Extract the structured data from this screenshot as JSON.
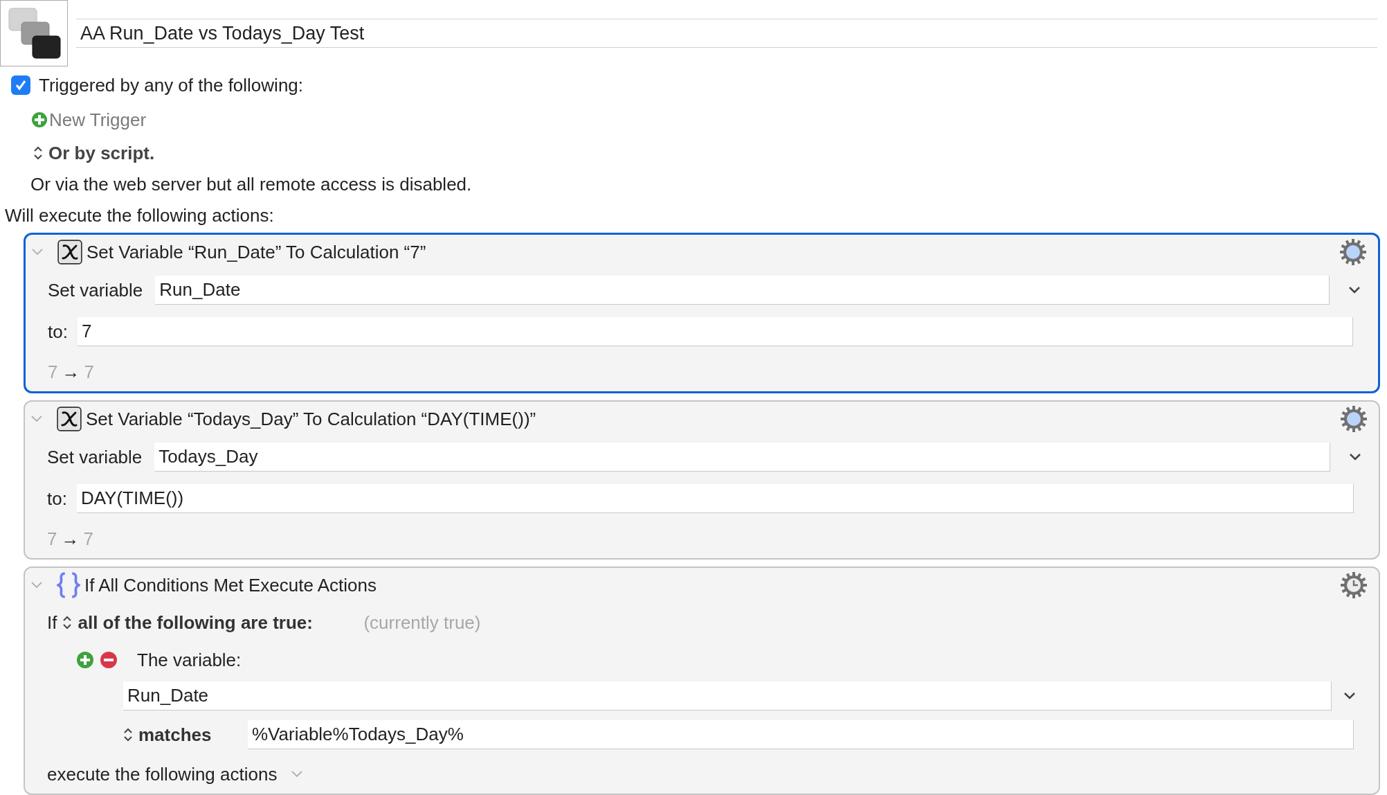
{
  "macro": {
    "name": "AA Run_Date vs Todays_Day Test"
  },
  "trigger": {
    "checked": true,
    "label": "Triggered by any of the following:"
  },
  "new_trigger": "New Trigger",
  "script_option": "Or by script.",
  "web_note": "Or via the web server but all remote access is disabled.",
  "actions_heading": "Will execute the following actions:",
  "actions": [
    {
      "kind": "set_variable",
      "selected": true,
      "title": "Set Variable “Run_Date” To Calculation “7”",
      "variable_label": "Set variable",
      "variable": "Run_Date",
      "to_label": "to:",
      "value": "7",
      "preview_from": "7",
      "arrow": "→",
      "preview_to": "7"
    },
    {
      "kind": "set_variable",
      "selected": false,
      "title": "Set Variable “Todays_Day” To Calculation “DAY(TIME())”",
      "variable_label": "Set variable",
      "variable": "Todays_Day",
      "to_label": "to:",
      "value": "DAY(TIME())",
      "preview_from": "7",
      "arrow": "→",
      "preview_to": "7"
    },
    {
      "kind": "if",
      "selected": false,
      "title": "If All Conditions Met Execute Actions",
      "if_label": "If",
      "condition_mode": "all of the following are true:",
      "status": "(currently true)",
      "condition": {
        "label": "The variable:",
        "variable": "Run_Date",
        "operator": "matches",
        "value": "%Variable%Todays_Day%"
      },
      "execute_label": "execute the following actions"
    }
  ]
}
